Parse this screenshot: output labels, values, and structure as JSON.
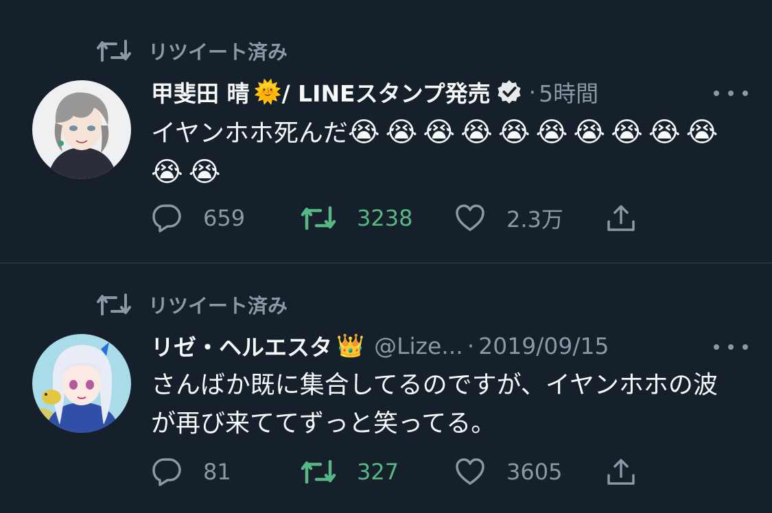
{
  "colors": {
    "background": "#15202b",
    "text_primary": "#f7f9f9",
    "text_secondary": "#8b98a5",
    "retweet_active": "#58b884",
    "divider": "#38444d"
  },
  "tweets": [
    {
      "retweet_label": "リツイート済み",
      "author_name": "甲斐田 晴",
      "name_emoji": "🌞",
      "name_suffix": " / LINEスタンプ発売",
      "verified": true,
      "separator": "·",
      "time": "5時間",
      "text": "イヤンホホ死んだ",
      "emojis": [
        "😭",
        "😭",
        "😭",
        "😭",
        "😭",
        "😭",
        "😭",
        "😭",
        "😭",
        "😭",
        "😭",
        "😭"
      ],
      "reply_count": "659",
      "retweet_count": "3238",
      "like_count": "2.3万",
      "icons": [
        "retweet-icon",
        "reply-icon",
        "like-icon",
        "share-icon",
        "verified-icon",
        "more-icon"
      ]
    },
    {
      "retweet_label": "リツイート済み",
      "author_name": "リゼ・ヘルエスタ",
      "name_emoji": "👑",
      "handle": "@Lize...",
      "separator": "·",
      "time": "2019/09/15",
      "text": "さんばか既に集合してるのですが、イヤンホホの波が再び来ててずっと笑ってる。",
      "reply_count": "81",
      "retweet_count": "327",
      "like_count": "3605"
    }
  ]
}
